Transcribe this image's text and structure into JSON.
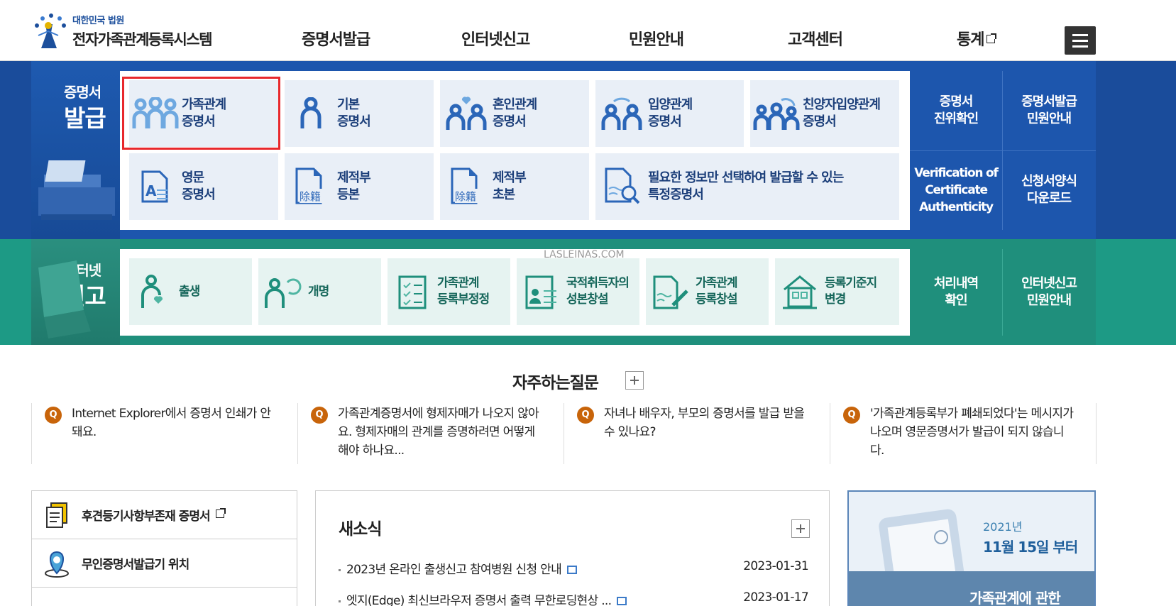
{
  "header": {
    "logo_sub": "대한민국 법원",
    "logo_main": "전자가족관계등록시스템",
    "nav": [
      "증명서발급",
      "인터넷신고",
      "민원안내",
      "고객센터",
      "통계"
    ],
    "menu_icon": "hamburger-icon"
  },
  "cert": {
    "side_small": "증명서",
    "side_big": "발급",
    "tiles": [
      {
        "line1": "가족관계",
        "line2": "증명서",
        "icon": "family-icon"
      },
      {
        "line1": "기본",
        "line2": "증명서",
        "icon": "person-icon"
      },
      {
        "line1": "혼인관계",
        "line2": "증명서",
        "icon": "couple-heart-icon"
      },
      {
        "line1": "입양관계",
        "line2": "증명서",
        "icon": "adoption-icon"
      },
      {
        "line1": "친양자입양관계",
        "line2": "증명서",
        "icon": "full-adoption-icon"
      },
      {
        "line1": "영문",
        "line2": "증명서",
        "icon": "english-doc-icon"
      },
      {
        "line1": "제적부",
        "line2": "등본",
        "icon": "removed-register-icon"
      },
      {
        "line1": "제적부",
        "line2": "초본",
        "icon": "removed-register-icon"
      },
      {
        "line1": "필요한 정보만 선택하여 발급할 수 있는",
        "line2": "특정증명서",
        "icon": "search-doc-icon"
      }
    ],
    "right": [
      {
        "line1": "증명서",
        "line2": "진위확인"
      },
      {
        "line1": "증명서발급",
        "line2": "민원안내"
      },
      {
        "line1": "Verification of",
        "line2": "Certificate",
        "line3": "Authenticity"
      },
      {
        "line1": "신청서양식",
        "line2": "다운로드"
      }
    ],
    "tile_badge": "除籍"
  },
  "report": {
    "side_small": "인터넷",
    "side_big": "신고",
    "tiles": [
      {
        "line1": "출생",
        "line2": "",
        "icon": "birth-icon"
      },
      {
        "line1": "개명",
        "line2": "",
        "icon": "rename-icon"
      },
      {
        "line1": "가족관계",
        "line2": "등록부정정",
        "icon": "checklist-icon"
      },
      {
        "line1": "국적취득자의",
        "line2": "성본창설",
        "icon": "id-card-icon"
      },
      {
        "line1": "가족관계",
        "line2": "등록창설",
        "icon": "doc-pen-icon"
      },
      {
        "line1": "등록기준지",
        "line2": "변경",
        "icon": "house-icon"
      }
    ],
    "right": [
      {
        "line1": "처리내역",
        "line2": "확인"
      },
      {
        "line1": "인터넷신고",
        "line2": "민원안내"
      }
    ]
  },
  "watermark": "LASLEINAS.COM",
  "faq": {
    "title": "자주하는질문",
    "q_badge": "Q",
    "items": [
      "Internet Explorer에서 증명서 인쇄가 안돼요.",
      "가족관계증명서에 형제자매가 나오지 않아요. 형제자매의 관계를 증명하려면 어떻게 해야 하나요...",
      "자녀나 배우자, 부모의 증명서를 발급 받을 수 있나요?",
      "'가족관계등록부가 폐쇄되었다'는 메시지가 나오며 영문증명서가 발급이 되지 않습니다."
    ]
  },
  "quick": {
    "items": [
      {
        "label": "후견등기사항부존재 증명서",
        "icon": "document-icon"
      },
      {
        "label": "무인증명서발급기 위치",
        "icon": "location-pin-icon"
      }
    ]
  },
  "news": {
    "title": "새소식",
    "items": [
      {
        "title": "2023년 온라인 출생신고 참여병원 신청 안내",
        "date": "2023-01-31"
      },
      {
        "title": "엣지(Edge) 최신브라우저 증명서 출력 무한로딩현상 ...",
        "date": "2023-01-17"
      }
    ]
  },
  "banner": {
    "year": "2021년",
    "date": "11월 15일 부터",
    "line": "가족관계에 관한"
  },
  "colors": {
    "cert_blue": "#1a4c9b",
    "report_green": "#1d9a85",
    "highlight_red": "#e8282c",
    "faq_orange": "#c8640a"
  }
}
